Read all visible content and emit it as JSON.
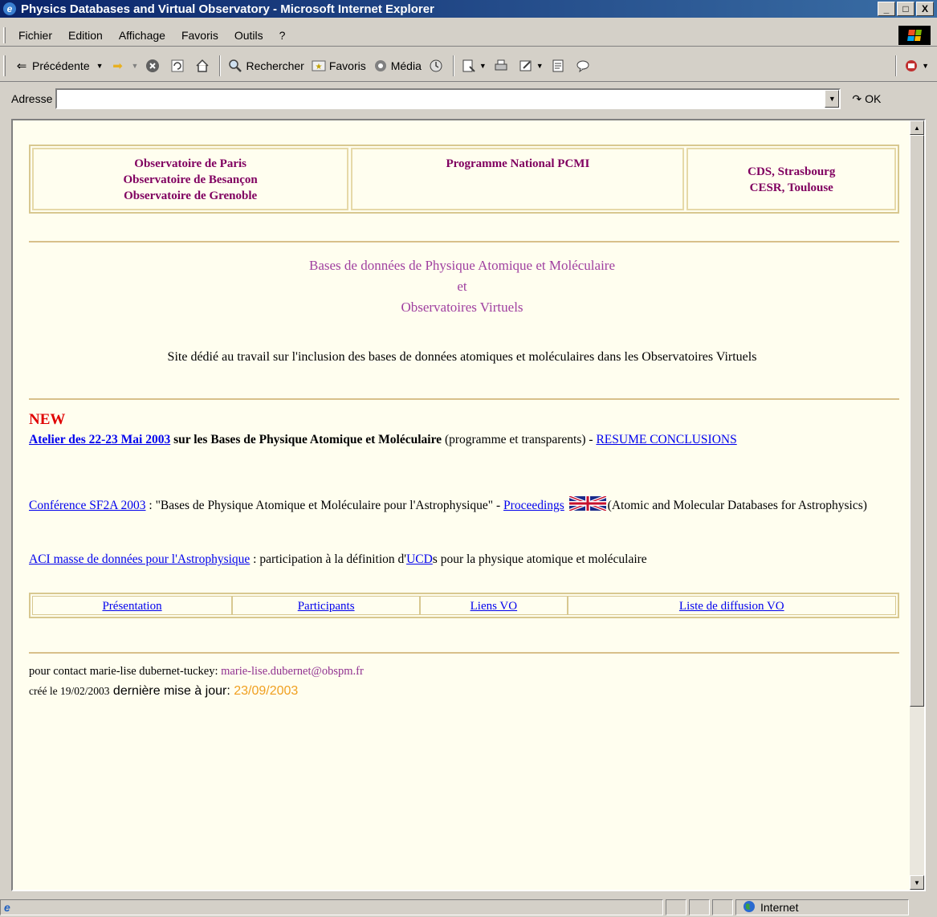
{
  "window": {
    "title": "Physics Databases and Virtual Observatory - Microsoft Internet Explorer",
    "minimize": "_",
    "maximize": "□",
    "close": "X"
  },
  "menubar": {
    "items": [
      "Fichier",
      "Edition",
      "Affichage",
      "Favoris",
      "Outils",
      "?"
    ]
  },
  "toolbar": {
    "back_label": "Précédente",
    "search_label": "Rechercher",
    "favorites_label": "Favoris",
    "media_label": "Média"
  },
  "addressbar": {
    "label": "Adresse",
    "value": "",
    "go_label": "OK"
  },
  "page": {
    "institutions": {
      "left": [
        "Observatoire de Paris",
        "Observatoire de Besançon",
        "Observatoire de Grenoble"
      ],
      "center": [
        "Programme National PCMI"
      ],
      "right": [
        "CDS, Strasbourg",
        "CESR, Toulouse"
      ]
    },
    "title_line1": "Bases de données de Physique Atomique et Moléculaire",
    "title_line2": "et",
    "title_line3": "Observatoires Virtuels",
    "subtitle": "Site dédié au travail sur l'inclusion des bases de données atomiques et moléculaires dans les Observatoires Virtuels",
    "new_label": "NEW",
    "news1": {
      "link": "Atelier des 22-23 Mai 2003",
      "bold_text": " sur les Bases de Physique Atomique et Moléculaire",
      "text": " (programme et transparents) - ",
      "link2": "RESUME CONCLUSIONS"
    },
    "news2": {
      "link": "Conférence SF2A 2003",
      "text": " : \"Bases de Physique Atomique et Moléculaire pour l'Astrophysique\" - ",
      "link2": "Proceedings",
      "text2": "(Atomic and Molecular Databases for Astrophysics)"
    },
    "news3": {
      "link": "ACI masse de données pour l'Astrophysique",
      "text": " : participation à la définition d'",
      "link2": "UCD",
      "text2": "s pour la physique atomique et moléculaire"
    },
    "nav": [
      "Présentation",
      "Participants",
      "Liens VO",
      "Liste de diffusion VO"
    ],
    "contact_prefix": "pour contact  marie-lise dubernet-tuckey: ",
    "contact_email": "marie-lise.dubernet@obspm.fr",
    "created": "créé le 19/02/2003",
    "updated_label": " dernière mise à jour: ",
    "updated_date": "23/09/2003"
  },
  "statusbar": {
    "zone": "Internet"
  }
}
